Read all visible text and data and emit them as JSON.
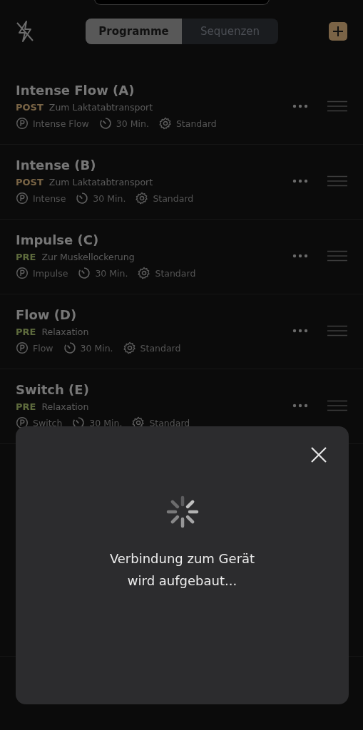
{
  "segmented_control": [
    {
      "label": "Programme",
      "selected": true
    },
    {
      "label": "Sequenzen",
      "selected": false
    }
  ],
  "programs": [
    {
      "title": "Intense Flow (A)",
      "phase": {
        "label": "POST",
        "kind": "post"
      },
      "description": "Zum Laktatabtransport",
      "program": "Intense Flow",
      "duration": "30 Min.",
      "mode": "Standard"
    },
    {
      "title": "Intense (B)",
      "phase": {
        "label": "POST",
        "kind": "post"
      },
      "description": "Zum Laktatabtransport",
      "program": "Intense",
      "duration": "30 Min.",
      "mode": "Standard"
    },
    {
      "title": "Impulse (C)",
      "phase": {
        "label": "PRE",
        "kind": "pre"
      },
      "description": "Zur Muskellockerung",
      "program": "Impulse",
      "duration": "30 Min.",
      "mode": "Standard"
    },
    {
      "title": "Flow (D)",
      "phase": {
        "label": "PRE",
        "kind": "pre"
      },
      "description": "Relaxation",
      "program": "Flow",
      "duration": "30 Min.",
      "mode": "Standard"
    },
    {
      "title": "Switch (E)",
      "phase": {
        "label": "PRE",
        "kind": "pre"
      },
      "description": "Relaxation",
      "program": "Switch",
      "duration": "30 Min.",
      "mode": "Standard"
    }
  ],
  "dialog": {
    "message": "Verbindung zum Gerät\nwird aufgebaut..."
  }
}
